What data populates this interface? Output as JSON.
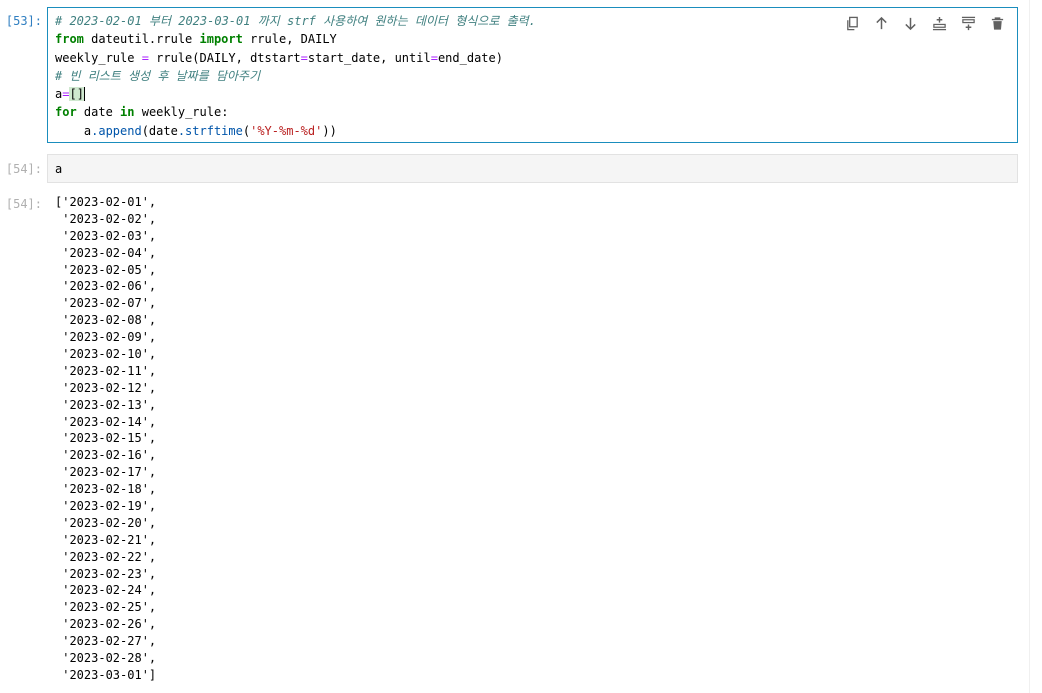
{
  "cells": [
    {
      "prompt": "[53]:",
      "code_lines": [
        {
          "parts": [
            {
              "t": "# 2023-02-01 부터 2023-03-01 까지 strf 사용하여 원하는 데이터 형식으로 출력.",
              "c": "cm"
            }
          ]
        },
        {
          "parts": [
            {
              "t": "from",
              "c": "kw"
            },
            {
              "t": " dateutil.rrule ",
              "c": ""
            },
            {
              "t": "import",
              "c": "kw"
            },
            {
              "t": " rrule, DAILY",
              "c": ""
            }
          ]
        },
        {
          "parts": [
            {
              "t": "weekly_rule ",
              "c": ""
            },
            {
              "t": "=",
              "c": "op"
            },
            {
              "t": " rrule(DAILY, dtstart",
              "c": ""
            },
            {
              "t": "=",
              "c": "op"
            },
            {
              "t": "start_date, until",
              "c": ""
            },
            {
              "t": "=",
              "c": "op"
            },
            {
              "t": "end_date)",
              "c": ""
            }
          ]
        },
        {
          "parts": [
            {
              "t": "# 빈 리스트 생성 후 날짜를 담아주기",
              "c": "cm"
            }
          ]
        },
        {
          "parts": [
            {
              "t": "a",
              "c": ""
            },
            {
              "t": "=",
              "c": "op"
            },
            {
              "t": "[]",
              "c": "cursor-bracket"
            }
          ]
        },
        {
          "parts": [
            {
              "t": "for",
              "c": "kw"
            },
            {
              "t": " date ",
              "c": ""
            },
            {
              "t": "in",
              "c": "kw"
            },
            {
              "t": " weekly_rule:",
              "c": ""
            }
          ]
        },
        {
          "parts": [
            {
              "t": "    a",
              "c": ""
            },
            {
              "t": ".append",
              "c": "fn"
            },
            {
              "t": "(date",
              "c": ""
            },
            {
              "t": ".strftime",
              "c": "fn"
            },
            {
              "t": "(",
              "c": ""
            },
            {
              "t": "'%Y-%m-%d'",
              "c": "str"
            },
            {
              "t": "))",
              "c": ""
            }
          ]
        }
      ]
    },
    {
      "prompt": "[54]:",
      "code": "a"
    }
  ],
  "output": {
    "prompt": "[54]:",
    "lines": [
      "['2023-02-01',",
      " '2023-02-02',",
      " '2023-02-03',",
      " '2023-02-04',",
      " '2023-02-05',",
      " '2023-02-06',",
      " '2023-02-07',",
      " '2023-02-08',",
      " '2023-02-09',",
      " '2023-02-10',",
      " '2023-02-11',",
      " '2023-02-12',",
      " '2023-02-13',",
      " '2023-02-14',",
      " '2023-02-15',",
      " '2023-02-16',",
      " '2023-02-17',",
      " '2023-02-18',",
      " '2023-02-19',",
      " '2023-02-20',",
      " '2023-02-21',",
      " '2023-02-22',",
      " '2023-02-23',",
      " '2023-02-24',",
      " '2023-02-25',",
      " '2023-02-26',",
      " '2023-02-27',",
      " '2023-02-28',",
      " '2023-03-01']"
    ]
  },
  "toolbar": [
    {
      "icon": "duplicate-icon"
    },
    {
      "icon": "arrow-up-icon"
    },
    {
      "icon": "arrow-down-icon"
    },
    {
      "icon": "insert-above-icon"
    },
    {
      "icon": "insert-below-icon"
    },
    {
      "icon": "trash-icon"
    }
  ],
  "colors": {
    "prompt_in": "#307fc1",
    "prompt_out": "#b0b0b0",
    "active_border": "#1a8dbd",
    "keyword": "#008000",
    "comment": "#408080",
    "string": "#ba2121",
    "operator": "#aa22ff",
    "icon": "#616161"
  }
}
